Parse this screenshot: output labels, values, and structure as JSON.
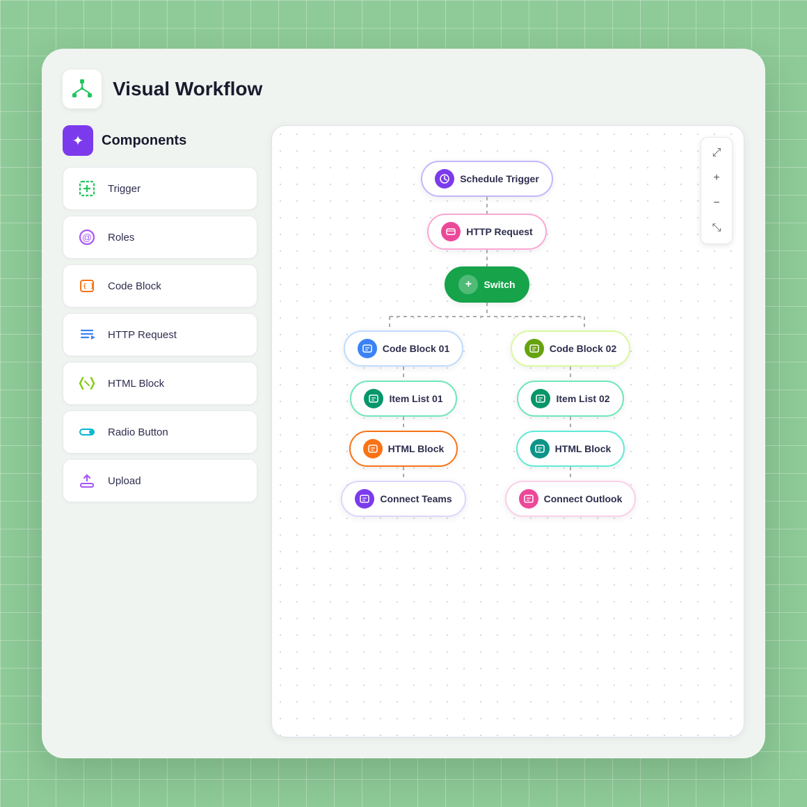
{
  "app": {
    "title": "Visual Workflow"
  },
  "components": {
    "header_label": "Components",
    "items": [
      {
        "id": "trigger",
        "label": "Trigger",
        "icon": "trigger-icon",
        "icon_char": "⊞",
        "icon_color": "#22c55e"
      },
      {
        "id": "roles",
        "label": "Roles",
        "icon": "roles-icon",
        "icon_char": "@",
        "icon_color": "#a855f7"
      },
      {
        "id": "code-block",
        "label": "Code Block",
        "icon": "code-block-icon",
        "icon_char": "{}",
        "icon_color": "#f97316"
      },
      {
        "id": "http-request",
        "label": "HTTP Request",
        "icon": "http-icon",
        "icon_char": "≡",
        "icon_color": "#3b82f6"
      },
      {
        "id": "html-block",
        "label": "HTML Block",
        "icon": "html-icon",
        "icon_char": "📎",
        "icon_color": "#84cc16"
      },
      {
        "id": "radio-button",
        "label": "Radio Button",
        "icon": "radio-icon",
        "icon_char": "◎",
        "icon_color": "#06b6d4"
      },
      {
        "id": "upload",
        "label": "Upload",
        "icon": "upload-icon",
        "icon_char": "⬆",
        "icon_color": "#a855f7"
      }
    ]
  },
  "workflow": {
    "nodes": {
      "schedule_trigger": {
        "label": "Schedule Trigger",
        "icon_color": "#7c3aed"
      },
      "http_request": {
        "label": "HTTP Request",
        "icon_color": "#ec4899"
      },
      "switch": {
        "label": "Switch",
        "icon_color": "#ffffff"
      },
      "code_block_01": {
        "label": "Code Block 01",
        "icon_color": "#3b82f6"
      },
      "code_block_02": {
        "label": "Code Block 02",
        "icon_color": "#65a30d"
      },
      "item_list_01": {
        "label": "Item List 01",
        "icon_color": "#059669"
      },
      "item_list_02": {
        "label": "Item List 02",
        "icon_color": "#059669"
      },
      "html_block_01": {
        "label": "HTML Block",
        "icon_color": "#f97316"
      },
      "html_block_02": {
        "label": "HTML Block",
        "icon_color": "#0d9488"
      },
      "connect_teams": {
        "label": "Connect Teams",
        "icon_color": "#7c3aed"
      },
      "connect_outlook": {
        "label": "Connect Outlook",
        "icon_color": "#ec4899"
      }
    }
  },
  "canvas_controls": {
    "expand_icon": "⤢",
    "zoom_in_icon": "+",
    "zoom_out_icon": "−",
    "fit_icon": "⤡"
  }
}
